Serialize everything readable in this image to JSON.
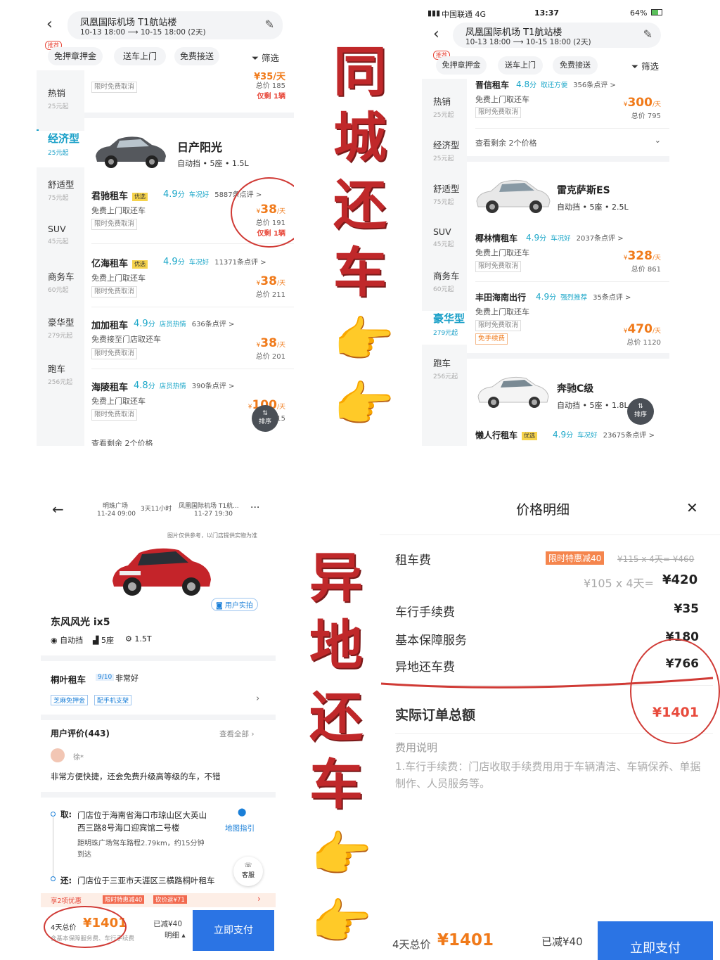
{
  "tl": {
    "location": "凤凰国际机场 T1航站楼",
    "dates": "10-13 18:00 ⟶ 10-15 18:00 (2天)",
    "rec_tag": "推荐",
    "chips": [
      "免押章押金",
      "送车上门",
      "免费接送"
    ],
    "filter": "筛选",
    "categories": [
      {
        "name": "热销",
        "price": "25元起"
      },
      {
        "name": "经济型",
        "price": "25元起"
      },
      {
        "name": "舒适型",
        "price": "75元起"
      },
      {
        "name": "SUV",
        "price": "45元起"
      },
      {
        "name": "商务车",
        "price": "60元起"
      },
      {
        "name": "豪华型",
        "price": "279元起"
      },
      {
        "name": "跑车",
        "price": "256元起"
      }
    ],
    "top_partial": {
      "cancel": "限时免费取消",
      "price": "¥35/天",
      "total": "总价 185",
      "only": "仅剩 1辆"
    },
    "car": {
      "name": "日产阳光",
      "spec": "自动挡 • 5座 • 1.5L"
    },
    "vendors": [
      {
        "name": "君驰租车",
        "badge": "优选",
        "score": "4.9",
        "unit": "分",
        "tag": "车况好",
        "reviews": "5887条点评 >",
        "service": "免费上门取还车",
        "cancel": "限时免费取消",
        "price": "38",
        "per": "/天",
        "total": "总价 191",
        "only": "仅剩 1辆"
      },
      {
        "name": "亿海租车",
        "badge": "优选",
        "score": "4.9",
        "unit": "分",
        "tag": "车况好",
        "reviews": "11371条点评 >",
        "service": "免费上门取还车",
        "cancel": "限时免费取消",
        "price": "38",
        "per": "/天",
        "total": "总价 211"
      },
      {
        "name": "加加租车",
        "score": "4.9",
        "unit": "分",
        "tag": "店员热情",
        "reviews": "636条点评 >",
        "service": "免费接至门店取还车",
        "cancel": "限时免费取消",
        "price": "38",
        "per": "/天",
        "total": "总价 201"
      },
      {
        "name": "海陵租车",
        "score": "4.8",
        "unit": "分",
        "tag": "店员热情",
        "reviews": "390条点评 >",
        "service": "免费上门取还车",
        "cancel": "限时免费取消",
        "price": "100",
        "per": "/天",
        "total": "总价 215"
      }
    ],
    "more": "查看剩余 2个价格",
    "sort": "排序"
  },
  "tr": {
    "status_carrier": "中国联通 4G",
    "status_time": "13:37",
    "status_battery": "64%",
    "location": "凤凰国际机场 T1航站楼",
    "dates": "10-13 18:00 ⟶ 10-15 18:00 (2天)",
    "rec_tag": "推荐",
    "chips": [
      "免押章押金",
      "送车上门",
      "免费接送"
    ],
    "filter": "筛选",
    "categories": [
      {
        "name": "热销",
        "price": "25元起"
      },
      {
        "name": "经济型",
        "price": "25元起"
      },
      {
        "name": "舒适型",
        "price": "75元起"
      },
      {
        "name": "SUV",
        "price": "45元起"
      },
      {
        "name": "商务车",
        "price": "60元起"
      },
      {
        "name": "豪华型",
        "price": "279元起"
      },
      {
        "name": "跑车",
        "price": "256元起"
      }
    ],
    "top_vendor": {
      "name": "晋信租车",
      "score": "4.8",
      "unit": "分",
      "tag": "取还方便",
      "reviews": "356条点评 >",
      "service": "免费上门取还车",
      "cancel": "限时免费取消",
      "price": "300",
      "per": "/天",
      "total": "总价 795"
    },
    "more": "查看剩余 2个价格",
    "car1": {
      "name": "雷克萨斯ES",
      "spec": "自动挡 • 5座 • 2.5L"
    },
    "v1": {
      "name": "椰林情租车",
      "score": "4.9",
      "unit": "分",
      "tag": "车况好",
      "reviews": "2037条点评 >",
      "service": "免费上门取还车",
      "cancel": "限时免费取消",
      "price": "328",
      "per": "/天",
      "total": "总价 861"
    },
    "v2": {
      "name": "丰田海南出行",
      "score": "4.9",
      "unit": "分",
      "tag": "强烈推荐",
      "reviews": "35条点评 >",
      "service": "免费上门取还车",
      "cancel": "限时免费取消",
      "fee": "免手续费",
      "price": "470",
      "per": "/天",
      "total": "总价 1120"
    },
    "car2": {
      "name": "奔驰C级",
      "spec": "自动挡 • 5座 • 1.8L"
    },
    "v3": {
      "name": "懒人行租车",
      "badge": "优选",
      "score": "4.9",
      "unit": "分",
      "tag": "车况好",
      "reviews": "23675条点评 >"
    },
    "sort": "排序"
  },
  "overlay": {
    "top": [
      "同",
      "城",
      "还",
      "车"
    ],
    "bottom": [
      "异",
      "地",
      "还",
      "车"
    ],
    "hand": "👉"
  },
  "bl": {
    "from": "明珠广场",
    "from_time": "11-24 09:00",
    "duration": "3天11小时",
    "to": "凤凰国际机场 T1航...",
    "to_time": "11-27 19:30",
    "more": "···",
    "disclaimer": "图片仅供参考，以门店提供实物为准",
    "photo_btn": "用户实拍",
    "car": "东风风光 ix5",
    "specs": [
      "自动挡",
      "5座",
      "1.5T"
    ],
    "vendor": "桐叶租车",
    "vendor_score": "9/10",
    "vendor_rating": "非常好",
    "vtags": [
      "芝麻免押金",
      "配手机支架"
    ],
    "reviews_title": "用户评价(443)",
    "reviews_all": "查看全部",
    "reviewer": "徐*",
    "review": "非常方便快捷，还会免费升级高等级的车，不错",
    "pick_label": "取:",
    "pick": "门店位于海南省海口市琼山区大英山西三路8号海口迎宾馆二号楼",
    "pick_dist": "距明珠广场驾车路程2.79km，约15分钟到达",
    "map": "地图指引",
    "return_label": "还:",
    "ret": "门店位于三亚市天涯区三横路桐叶租车",
    "service": "客服",
    "promo_lead": "享2项优惠",
    "promo1": "限时特惠减40",
    "promo2": "砍价返¥71",
    "total_label": "4天总价",
    "total": "¥1401",
    "total_sub": "含基本保障服务费、车行手续费",
    "discount": "已减¥40",
    "detail": "明细",
    "pay": "立即支付"
  },
  "br": {
    "title": "价格明细",
    "close": "✕",
    "rent_label": "租车费",
    "promo": "限时特惠减40",
    "orig": "¥115 x 4天= ¥460",
    "calc": "¥105 x 4天=",
    "calc_total": "¥420",
    "rows": [
      {
        "label": "车行手续费",
        "value": "¥35"
      },
      {
        "label": "基本保障服务",
        "value": "¥180"
      },
      {
        "label": "异地还车费",
        "value": "¥766"
      }
    ],
    "total_label": "实际订单总额",
    "total": "¥1401",
    "note_title": "费用说明",
    "note": "1.车行手续费：门店收取手续费用用于车辆清洁、车辆保养、单据制作、人员服务等。",
    "foot_label": "4天总价",
    "foot_total": "¥1401",
    "foot_discount": "已减¥40",
    "pay": "立即支付"
  },
  "colors": {
    "brand": "#1aa0c8",
    "price": "#f07a1a",
    "annotation": "#d03a35",
    "pay": "#2b74e4"
  }
}
